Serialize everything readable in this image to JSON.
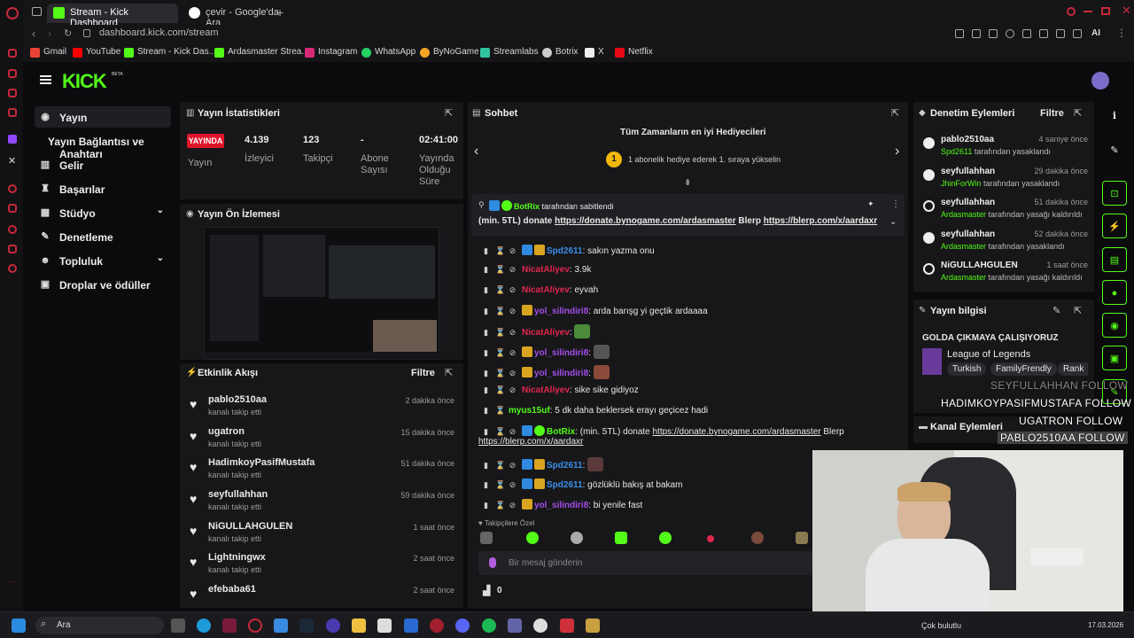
{
  "browser": {
    "tabs": [
      {
        "label": "Stream - Kick Dashboard"
      },
      {
        "label": "çevir - Google'da Ara"
      }
    ],
    "new_tab_icon": "plus-icon",
    "url": "dashboard.kick.com/stream",
    "bookmarks": [
      "Gmail",
      "YouTube",
      "Stream - Kick Das...",
      "Ardasmaster Strea...",
      "Instagram",
      "WhatsApp",
      "ByNoGame",
      "Streamlabs",
      "Botrix",
      "X",
      "Netflix"
    ],
    "ai_label": "AI"
  },
  "kick": {
    "logo": "KICK",
    "logo_sup": "BETA"
  },
  "sidebar": {
    "items": [
      {
        "label": "Yayın",
        "icon": "broadcast-icon"
      },
      {
        "label": "Yayın Bağlantısı ve Anahtarı",
        "icon": "key-icon"
      },
      {
        "label": "Gelir",
        "icon": "chart-icon"
      },
      {
        "label": "Başarılar",
        "icon": "trophy-icon"
      },
      {
        "label": "Stüdyo",
        "icon": "studio-icon"
      },
      {
        "label": "Denetleme",
        "icon": "wrench-icon"
      },
      {
        "label": "Topluluk",
        "icon": "people-icon"
      },
      {
        "label": "Droplar ve ödüller",
        "icon": "gift-icon"
      }
    ]
  },
  "stats": {
    "title": "Yayın İstatistikleri",
    "live_badge": "YAYINDA",
    "live_label": "Yayın",
    "viewers_value": "4.139",
    "viewers_label": "İzleyici",
    "followers_value": "123",
    "followers_label": "Takipçi",
    "subs_value": "-",
    "subs_label_1": "Abone",
    "subs_label_2": "Sayısı",
    "duration_value": "02:41:00",
    "duration_label_1": "Yayında",
    "duration_label_2": "Olduğu",
    "duration_label_3": "Süre"
  },
  "preview": {
    "title": "Yayın Ön İzlemesi"
  },
  "activity": {
    "title": "Etkinlik Akışı",
    "filter": "Filtre",
    "events": [
      {
        "name": "pablo2510aa",
        "sub": "kanalı takip etti",
        "time": "2 dakika önce"
      },
      {
        "name": "ugatron",
        "sub": "kanalı takip etti",
        "time": "15 dakika önce"
      },
      {
        "name": "HadimkoyPasifMustafa",
        "sub": "kanalı takip etti",
        "time": "51 dakika önce"
      },
      {
        "name": "seyfullahhan",
        "sub": "kanalı takip etti",
        "time": "59 dakika önce"
      },
      {
        "name": "NiGULLAHGULEN",
        "sub": "kanalı takip etti",
        "time": "1 saat önce"
      },
      {
        "name": "Lightningwx",
        "sub": "kanalı takip etti",
        "time": "2 saat önce"
      },
      {
        "name": "efebaba61",
        "sub": "kanalı takip etti",
        "time": "2 saat önce"
      }
    ]
  },
  "chat": {
    "title": "Sohbet",
    "gifters_title": "Tüm Zamanların en iyi Hediyecileri",
    "gifters_rank": "1",
    "gifters_text": "1 abonelik hediye ederek 1. sıraya yükselin",
    "pinned_user": "BotRix",
    "pinned_suffix": "tarafından sabitlendi",
    "pinned_prefix": "(min. 5TL) donate",
    "pinned_link1": "https://donate.bynogame.com/ardasmaster",
    "pinned_mid": "Blerp",
    "pinned_link2": "https://blerp.com/x/aardaxr",
    "messages": [
      {
        "user": "Spd2611",
        "text": ": sakın yazma onu"
      },
      {
        "user": "NicatAliyev",
        "text": ": 3.9k"
      },
      {
        "user": "NicatAliyev",
        "text": ": eyvah"
      },
      {
        "user": "yol_silindiri8",
        "text": ": arda barışg yi geçtik ardaaaa"
      },
      {
        "user": "NicatAliyev",
        "text": ":"
      },
      {
        "user": "yol_silindiri8",
        "text": ":"
      },
      {
        "user": "yol_silindiri8",
        "text": ":"
      },
      {
        "user": "NicatAliyev",
        "text": ": sike sike gidiyoz"
      },
      {
        "user": "myus15uf",
        "text": ": 5 dk daha beklersek erayı geçicez hadi"
      },
      {
        "user": "BotRix",
        "text": ": (min. 5TL) donate",
        "link1": "https://donate.bynogame.com/ardasmaster",
        "mid": "Blerp",
        "link2": "https://blerp.com/x/aardaxr"
      },
      {
        "user": "Spd2611",
        "text": ":"
      },
      {
        "user": "Spd2611",
        "text": ": gözlüklü bakış at bakam"
      },
      {
        "user": "yol_silindiri8",
        "text": ": bi yenile fast"
      }
    ],
    "followers_only": "Takipçilere Özel",
    "input_placeholder": "Bir mesaj gönderin",
    "points": "0"
  },
  "moderation": {
    "title": "Denetim Eylemleri",
    "filter": "Filtre",
    "actions": [
      {
        "user": "pablo2510aa",
        "time": "4 saniye önce",
        "by": "Spd2611",
        "desc": "tarafından yasaklandı"
      },
      {
        "user": "seyfullahhan",
        "time": "29 dakika önce",
        "by": "JhinForWin",
        "desc": "tarafından yasaklandı"
      },
      {
        "user": "seyfullahhan",
        "time": "51 dakika önce",
        "by": "Ardasmaster",
        "desc": "tarafından yasağı kaldırıldı"
      },
      {
        "user": "seyfullahhan",
        "time": "52 dakika önce",
        "by": "Ardasmaster",
        "desc": "tarafından yasaklandı"
      },
      {
        "user": "NiGULLAHGULEN",
        "time": "1 saat önce",
        "by": "Ardasmaster",
        "desc": "tarafından yasağı kaldırıldı"
      }
    ]
  },
  "stream_info": {
    "title": "Yayın bilgisi",
    "stream_title": "GOLDA ÇIKMAYA ÇALIŞIYORUZ",
    "category": "League of Legends",
    "tags": [
      "Turkish",
      "FamilyFrendly",
      "Rank"
    ]
  },
  "channel_actions": {
    "title": "Kanal Eylemleri"
  },
  "overlay": {
    "follows": [
      {
        "name": "SEYFULLAHHAN",
        "tag": "FOLLOW"
      },
      {
        "name": "HADIMKOYPASIFMUSTAFA",
        "tag": "FOLLOW"
      },
      {
        "name": "UGATRON",
        "tag": "FOLLOW"
      },
      {
        "name": "PABLO2510AA",
        "tag": "FOLLOW"
      }
    ]
  },
  "taskbar": {
    "search": "Ara",
    "weather": "Çok bulutlu",
    "date": "17.03.2026"
  },
  "colors": {
    "accent": "#53fc18",
    "live": "#e0142a",
    "panel": "#17171a"
  }
}
